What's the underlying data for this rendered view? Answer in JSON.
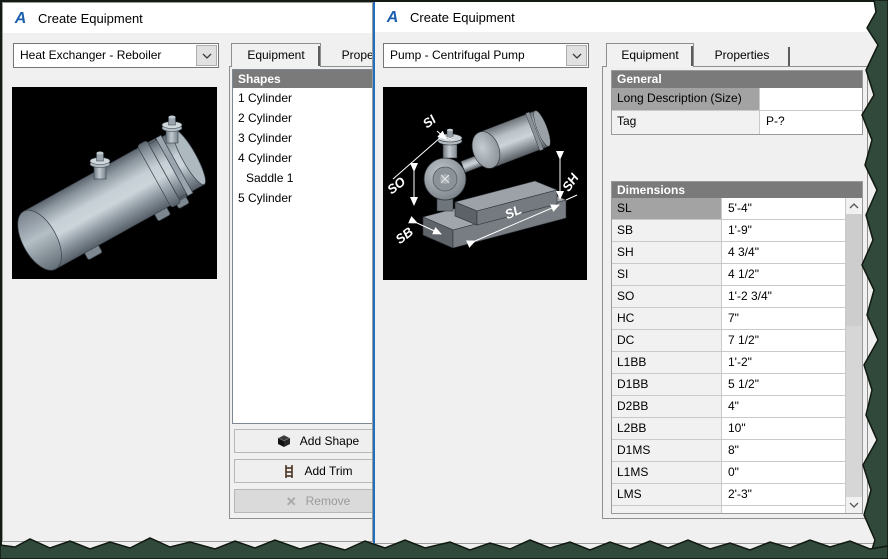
{
  "colors": {
    "accent_border": "#1f6fbe",
    "titlebar_bg": "#ffffff",
    "window_bg": "#f0f0f0",
    "section_header_bg": "#7a7a7a",
    "selected_cell_bg": "#a3a3a3",
    "logo_blue": "#1b5fad",
    "tear": "#31493a"
  },
  "icons": {
    "autocad_logo": "A",
    "remove_x": "✕"
  },
  "left_window": {
    "title": "Create Equipment",
    "equipment_type": "Heat Exchanger - Reboiler",
    "tabs": [
      {
        "label": "Equipment"
      },
      {
        "label": "Properties"
      }
    ],
    "shapes": {
      "header": "Shapes",
      "items": [
        "1 Cylinder",
        "2 Cylinder",
        "3 Cylinder",
        "4 Cylinder",
        "Saddle 1",
        "5 Cylinder"
      ]
    },
    "buttons": {
      "add_shape": "Add Shape",
      "add_trim": "Add Trim",
      "remove": "Remove"
    }
  },
  "right_window": {
    "title": "Create Equipment",
    "equipment_type": "Pump - Centrifugal Pump",
    "tabs": [
      {
        "label": "Equipment"
      },
      {
        "label": "Properties"
      }
    ],
    "general": {
      "header": "General",
      "rows": [
        {
          "label": "Long Description (Size)",
          "value": ""
        },
        {
          "label": "Tag",
          "value": "P-?"
        }
      ]
    },
    "dimensions": {
      "header": "Dimensions",
      "rows": [
        {
          "label": "SL",
          "value": "5'-4\""
        },
        {
          "label": "SB",
          "value": "1'-9\""
        },
        {
          "label": "SH",
          "value": "4 3/4\""
        },
        {
          "label": "SI",
          "value": "4 1/2\""
        },
        {
          "label": "SO",
          "value": "1'-2 3/4\""
        },
        {
          "label": "HC",
          "value": "7\""
        },
        {
          "label": "DC",
          "value": "7 1/2\""
        },
        {
          "label": "L1BB",
          "value": "1'-2\""
        },
        {
          "label": "D1BB",
          "value": "5 1/2\""
        },
        {
          "label": "D2BB",
          "value": "4\""
        },
        {
          "label": "L2BB",
          "value": "10\""
        },
        {
          "label": "D1MS",
          "value": "8\""
        },
        {
          "label": "L1MS",
          "value": "0\""
        },
        {
          "label": "LMS",
          "value": "2'-3\""
        }
      ]
    },
    "preview_labels": {
      "si": "SI",
      "so": "SO",
      "sb": "SB",
      "sl": "SL",
      "sh": "SH"
    }
  }
}
